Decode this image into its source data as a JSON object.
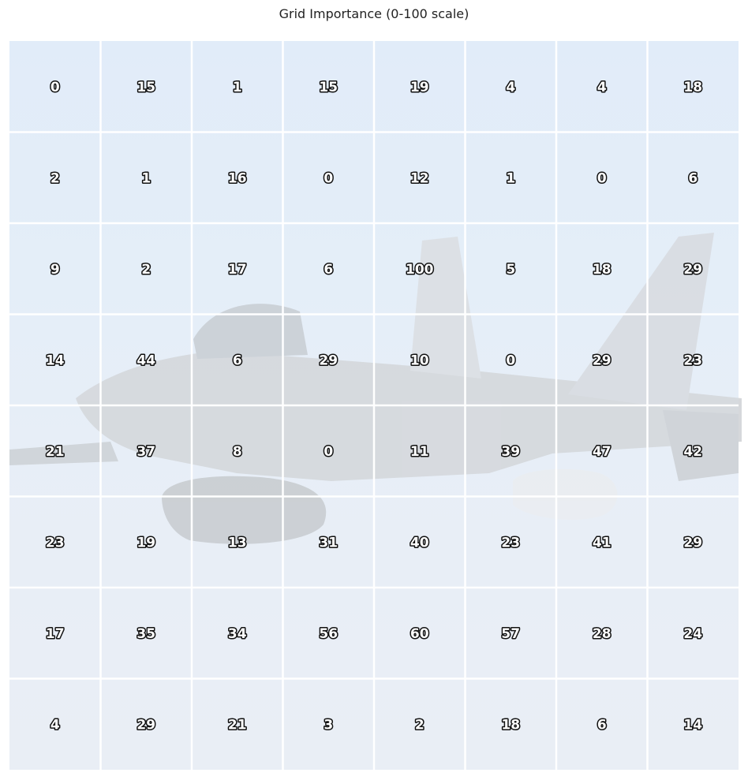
{
  "chart_data": {
    "type": "heatmap",
    "title": "Grid Importance (0-100 scale)",
    "rows": 8,
    "cols": 8,
    "values": [
      [
        0,
        15,
        1,
        15,
        19,
        4,
        4,
        18
      ],
      [
        2,
        1,
        16,
        0,
        12,
        1,
        0,
        6
      ],
      [
        9,
        2,
        17,
        6,
        100,
        5,
        18,
        29
      ],
      [
        14,
        44,
        6,
        29,
        10,
        0,
        29,
        23
      ],
      [
        21,
        37,
        8,
        0,
        11,
        39,
        47,
        42
      ],
      [
        23,
        19,
        13,
        31,
        40,
        23,
        41,
        29
      ],
      [
        17,
        35,
        34,
        56,
        60,
        57,
        28,
        24
      ],
      [
        4,
        29,
        21,
        3,
        2,
        18,
        6,
        14
      ]
    ],
    "grid": true,
    "grid_color": "#ffffff",
    "background": "photo of a grey fighter jet against a pale blue sky, faded"
  }
}
